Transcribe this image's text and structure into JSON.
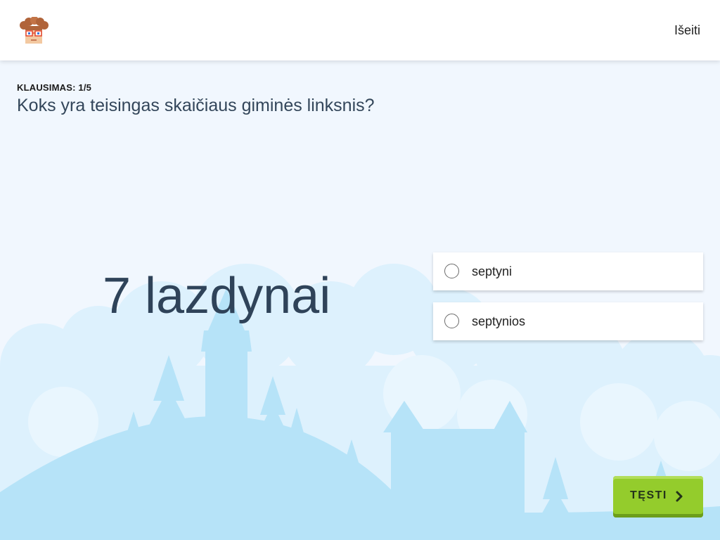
{
  "header": {
    "avatar_icon": "boy-with-glasses-avatar-icon",
    "exit_label": "Išeiti"
  },
  "question": {
    "counter": "KLAUSIMAS: 1/5",
    "text": "Koks yra teisingas skaičiaus giminės linksnis?",
    "phrase": "7 lazdynai"
  },
  "options": [
    {
      "label": "septyni",
      "selected": false
    },
    {
      "label": "septynios",
      "selected": false
    }
  ],
  "footer": {
    "continue_label": "TĘSTI",
    "continue_icon": "chevron-right-icon"
  },
  "colors": {
    "background": "#f1f7fe",
    "silhouette": "#b6e3f8",
    "clouds": "#ddf1fd",
    "button_green": "#94cc2c",
    "text_dark": "#2f4359"
  }
}
